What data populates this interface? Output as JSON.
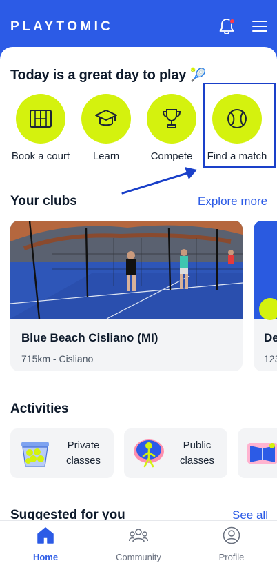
{
  "app": {
    "logo_text": "PLAYTOMIC"
  },
  "colors": {
    "brand_blue": "#2c5be6",
    "accent_lime": "#d4f20e",
    "notification": "#ff3b4a",
    "annotation": "#1a40c9"
  },
  "header": {
    "icons": [
      "bell-icon",
      "hamburger-menu-icon"
    ],
    "has_notification": true
  },
  "greeting": {
    "title": "Today is a great day to play",
    "emoji": "🎾"
  },
  "quick_actions": [
    {
      "label": "Book a court",
      "icon": "court-icon"
    },
    {
      "label": "Learn",
      "icon": "graduation-cap-icon"
    },
    {
      "label": "Compete",
      "icon": "trophy-icon"
    },
    {
      "label": "Find a match",
      "icon": "ball-icon",
      "highlighted": true
    }
  ],
  "clubs": {
    "title": "Your clubs",
    "link": "Explore more",
    "items": [
      {
        "name": "Blue Beach Cisliano (MI)",
        "subtitle": "715km - Cisliano"
      },
      {
        "name": "De",
        "subtitle": "123"
      }
    ]
  },
  "activities": {
    "title": "Activities",
    "items": [
      {
        "line1": "Private",
        "line2": "classes",
        "icon": "ball-basket-icon"
      },
      {
        "line1": "Public",
        "line2": "classes",
        "icon": "player-icon"
      },
      {
        "line1": "",
        "line2": "",
        "icon": "court-map-icon"
      }
    ]
  },
  "suggested": {
    "title": "Suggested for you",
    "link": "See all"
  },
  "tabbar": {
    "items": [
      {
        "label": "Home",
        "icon": "home-icon",
        "active": true
      },
      {
        "label": "Community",
        "icon": "community-icon",
        "active": false
      },
      {
        "label": "Profile",
        "icon": "profile-icon",
        "active": false
      }
    ]
  }
}
